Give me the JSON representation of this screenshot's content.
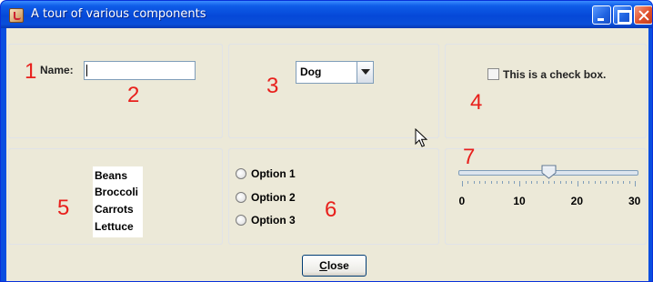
{
  "window": {
    "title": "A tour of various components"
  },
  "callouts": {
    "n1": "1",
    "n2": "2",
    "n3": "3",
    "n4": "4",
    "n5": "5",
    "n6": "6",
    "n7": "7"
  },
  "name_field": {
    "label": "Name:",
    "value": ""
  },
  "combo": {
    "selected": "Dog"
  },
  "checkbox": {
    "label": "This is a check box.",
    "checked": false
  },
  "list": {
    "items": [
      "Beans",
      "Broccoli",
      "Carrots",
      "Lettuce"
    ]
  },
  "radios": {
    "options": [
      "Option 1",
      "Option 2",
      "Option 3"
    ],
    "selected": null
  },
  "slider": {
    "min": 0,
    "max": 30,
    "value": 15,
    "labels": [
      "0",
      "10",
      "20",
      "30"
    ]
  },
  "close_button": {
    "label_first": "C",
    "label_rest": "lose"
  },
  "colors": {
    "callout_red": "#e8201c",
    "titlebar_blue": "#0548d8",
    "client_bg": "#ece9d8"
  }
}
